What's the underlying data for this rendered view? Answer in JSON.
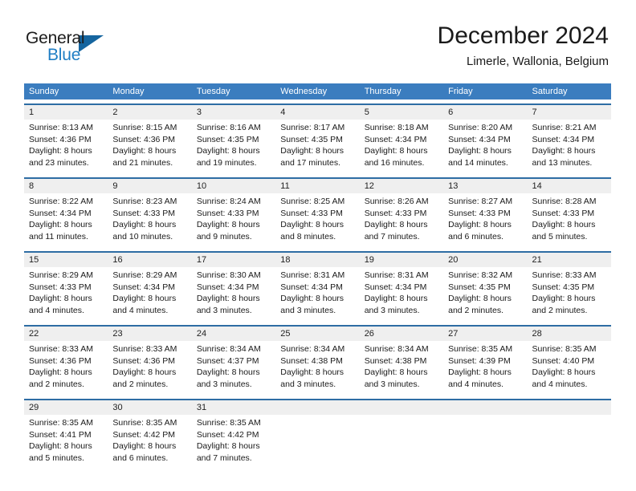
{
  "brand": {
    "name_part1": "General",
    "name_part2": "Blue",
    "triangle_color": "#15659f",
    "blue_color": "#1f7ec4"
  },
  "header": {
    "title": "December 2024",
    "location": "Limerle, Wallonia, Belgium"
  },
  "theme": {
    "header_row_bg": "#3b7dbf",
    "week_divider": "#2e6da4",
    "day_band_bg": "#efefef",
    "text": "#1a1a1a"
  },
  "weekdays": [
    "Sunday",
    "Monday",
    "Tuesday",
    "Wednesday",
    "Thursday",
    "Friday",
    "Saturday"
  ],
  "weeks": [
    [
      {
        "day": "1",
        "sunrise": "Sunrise: 8:13 AM",
        "sunset": "Sunset: 4:36 PM",
        "daylight1": "Daylight: 8 hours",
        "daylight2": "and 23 minutes."
      },
      {
        "day": "2",
        "sunrise": "Sunrise: 8:15 AM",
        "sunset": "Sunset: 4:36 PM",
        "daylight1": "Daylight: 8 hours",
        "daylight2": "and 21 minutes."
      },
      {
        "day": "3",
        "sunrise": "Sunrise: 8:16 AM",
        "sunset": "Sunset: 4:35 PM",
        "daylight1": "Daylight: 8 hours",
        "daylight2": "and 19 minutes."
      },
      {
        "day": "4",
        "sunrise": "Sunrise: 8:17 AM",
        "sunset": "Sunset: 4:35 PM",
        "daylight1": "Daylight: 8 hours",
        "daylight2": "and 17 minutes."
      },
      {
        "day": "5",
        "sunrise": "Sunrise: 8:18 AM",
        "sunset": "Sunset: 4:34 PM",
        "daylight1": "Daylight: 8 hours",
        "daylight2": "and 16 minutes."
      },
      {
        "day": "6",
        "sunrise": "Sunrise: 8:20 AM",
        "sunset": "Sunset: 4:34 PM",
        "daylight1": "Daylight: 8 hours",
        "daylight2": "and 14 minutes."
      },
      {
        "day": "7",
        "sunrise": "Sunrise: 8:21 AM",
        "sunset": "Sunset: 4:34 PM",
        "daylight1": "Daylight: 8 hours",
        "daylight2": "and 13 minutes."
      }
    ],
    [
      {
        "day": "8",
        "sunrise": "Sunrise: 8:22 AM",
        "sunset": "Sunset: 4:34 PM",
        "daylight1": "Daylight: 8 hours",
        "daylight2": "and 11 minutes."
      },
      {
        "day": "9",
        "sunrise": "Sunrise: 8:23 AM",
        "sunset": "Sunset: 4:33 PM",
        "daylight1": "Daylight: 8 hours",
        "daylight2": "and 10 minutes."
      },
      {
        "day": "10",
        "sunrise": "Sunrise: 8:24 AM",
        "sunset": "Sunset: 4:33 PM",
        "daylight1": "Daylight: 8 hours",
        "daylight2": "and 9 minutes."
      },
      {
        "day": "11",
        "sunrise": "Sunrise: 8:25 AM",
        "sunset": "Sunset: 4:33 PM",
        "daylight1": "Daylight: 8 hours",
        "daylight2": "and 8 minutes."
      },
      {
        "day": "12",
        "sunrise": "Sunrise: 8:26 AM",
        "sunset": "Sunset: 4:33 PM",
        "daylight1": "Daylight: 8 hours",
        "daylight2": "and 7 minutes."
      },
      {
        "day": "13",
        "sunrise": "Sunrise: 8:27 AM",
        "sunset": "Sunset: 4:33 PM",
        "daylight1": "Daylight: 8 hours",
        "daylight2": "and 6 minutes."
      },
      {
        "day": "14",
        "sunrise": "Sunrise: 8:28 AM",
        "sunset": "Sunset: 4:33 PM",
        "daylight1": "Daylight: 8 hours",
        "daylight2": "and 5 minutes."
      }
    ],
    [
      {
        "day": "15",
        "sunrise": "Sunrise: 8:29 AM",
        "sunset": "Sunset: 4:33 PM",
        "daylight1": "Daylight: 8 hours",
        "daylight2": "and 4 minutes."
      },
      {
        "day": "16",
        "sunrise": "Sunrise: 8:29 AM",
        "sunset": "Sunset: 4:34 PM",
        "daylight1": "Daylight: 8 hours",
        "daylight2": "and 4 minutes."
      },
      {
        "day": "17",
        "sunrise": "Sunrise: 8:30 AM",
        "sunset": "Sunset: 4:34 PM",
        "daylight1": "Daylight: 8 hours",
        "daylight2": "and 3 minutes."
      },
      {
        "day": "18",
        "sunrise": "Sunrise: 8:31 AM",
        "sunset": "Sunset: 4:34 PM",
        "daylight1": "Daylight: 8 hours",
        "daylight2": "and 3 minutes."
      },
      {
        "day": "19",
        "sunrise": "Sunrise: 8:31 AM",
        "sunset": "Sunset: 4:34 PM",
        "daylight1": "Daylight: 8 hours",
        "daylight2": "and 3 minutes."
      },
      {
        "day": "20",
        "sunrise": "Sunrise: 8:32 AM",
        "sunset": "Sunset: 4:35 PM",
        "daylight1": "Daylight: 8 hours",
        "daylight2": "and 2 minutes."
      },
      {
        "day": "21",
        "sunrise": "Sunrise: 8:33 AM",
        "sunset": "Sunset: 4:35 PM",
        "daylight1": "Daylight: 8 hours",
        "daylight2": "and 2 minutes."
      }
    ],
    [
      {
        "day": "22",
        "sunrise": "Sunrise: 8:33 AM",
        "sunset": "Sunset: 4:36 PM",
        "daylight1": "Daylight: 8 hours",
        "daylight2": "and 2 minutes."
      },
      {
        "day": "23",
        "sunrise": "Sunrise: 8:33 AM",
        "sunset": "Sunset: 4:36 PM",
        "daylight1": "Daylight: 8 hours",
        "daylight2": "and 2 minutes."
      },
      {
        "day": "24",
        "sunrise": "Sunrise: 8:34 AM",
        "sunset": "Sunset: 4:37 PM",
        "daylight1": "Daylight: 8 hours",
        "daylight2": "and 3 minutes."
      },
      {
        "day": "25",
        "sunrise": "Sunrise: 8:34 AM",
        "sunset": "Sunset: 4:38 PM",
        "daylight1": "Daylight: 8 hours",
        "daylight2": "and 3 minutes."
      },
      {
        "day": "26",
        "sunrise": "Sunrise: 8:34 AM",
        "sunset": "Sunset: 4:38 PM",
        "daylight1": "Daylight: 8 hours",
        "daylight2": "and 3 minutes."
      },
      {
        "day": "27",
        "sunrise": "Sunrise: 8:35 AM",
        "sunset": "Sunset: 4:39 PM",
        "daylight1": "Daylight: 8 hours",
        "daylight2": "and 4 minutes."
      },
      {
        "day": "28",
        "sunrise": "Sunrise: 8:35 AM",
        "sunset": "Sunset: 4:40 PM",
        "daylight1": "Daylight: 8 hours",
        "daylight2": "and 4 minutes."
      }
    ],
    [
      {
        "day": "29",
        "sunrise": "Sunrise: 8:35 AM",
        "sunset": "Sunset: 4:41 PM",
        "daylight1": "Daylight: 8 hours",
        "daylight2": "and 5 minutes."
      },
      {
        "day": "30",
        "sunrise": "Sunrise: 8:35 AM",
        "sunset": "Sunset: 4:42 PM",
        "daylight1": "Daylight: 8 hours",
        "daylight2": "and 6 minutes."
      },
      {
        "day": "31",
        "sunrise": "Sunrise: 8:35 AM",
        "sunset": "Sunset: 4:42 PM",
        "daylight1": "Daylight: 8 hours",
        "daylight2": "and 7 minutes."
      },
      {
        "day": "",
        "sunrise": "",
        "sunset": "",
        "daylight1": "",
        "daylight2": ""
      },
      {
        "day": "",
        "sunrise": "",
        "sunset": "",
        "daylight1": "",
        "daylight2": ""
      },
      {
        "day": "",
        "sunrise": "",
        "sunset": "",
        "daylight1": "",
        "daylight2": ""
      },
      {
        "day": "",
        "sunrise": "",
        "sunset": "",
        "daylight1": "",
        "daylight2": ""
      }
    ]
  ]
}
